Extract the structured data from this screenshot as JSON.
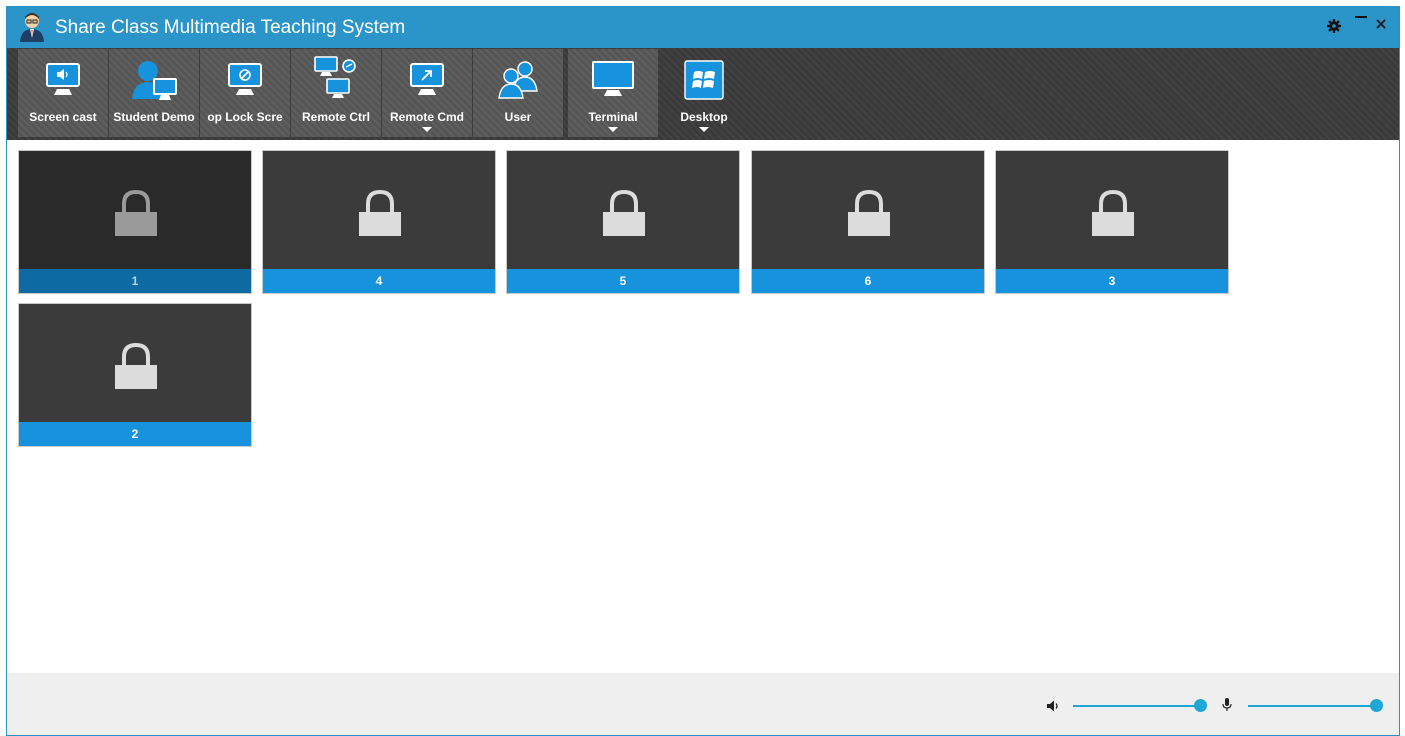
{
  "app": {
    "title": "Share Class Multimedia Teaching System"
  },
  "toolbar": {
    "items": [
      {
        "label": "Screen cast",
        "icon": "screen-cast-icon"
      },
      {
        "label": "Student Demo",
        "icon": "student-demo-icon"
      },
      {
        "label": "op Lock Scre",
        "icon": "lock-screen-icon"
      },
      {
        "label": "Remote Ctrl",
        "icon": "remote-ctrl-icon"
      },
      {
        "label": "Remote Cmd",
        "icon": "remote-cmd-icon",
        "dropdown": true
      },
      {
        "label": "User",
        "icon": "user-icon"
      },
      {
        "label": "Terminal",
        "icon": "terminal-icon",
        "dropdown": true
      },
      {
        "label": "Desktop",
        "icon": "desktop-icon",
        "dropdown": true
      }
    ]
  },
  "terminals": [
    {
      "label": "1",
      "locked": true,
      "selected": true
    },
    {
      "label": "4",
      "locked": true
    },
    {
      "label": "5",
      "locked": true
    },
    {
      "label": "6",
      "locked": true
    },
    {
      "label": "3",
      "locked": true
    },
    {
      "label": "2",
      "locked": true
    }
  ],
  "footer": {
    "volume": {
      "icon": "speaker-icon",
      "level": 1.0
    },
    "microphone": {
      "icon": "microphone-icon",
      "level": 1.0
    }
  },
  "colors": {
    "titlebar": "#2b94c9",
    "toolbar": "#3a3a3a",
    "tile_bar": "#1693dc",
    "tile_bar_selected": "#0d6aa3",
    "slider": "#1fa7d6"
  }
}
